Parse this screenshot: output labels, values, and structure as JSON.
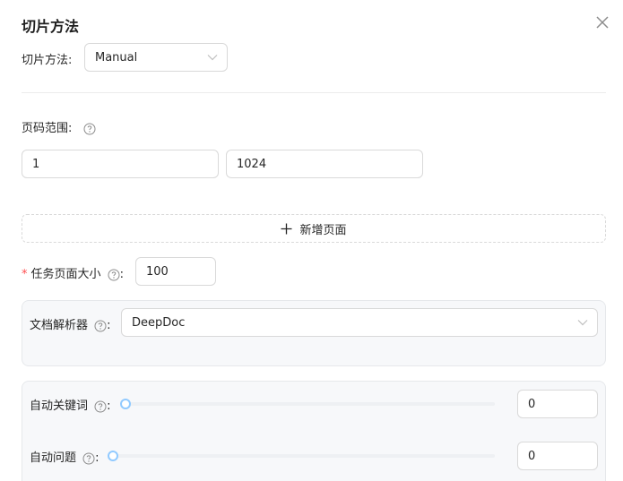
{
  "dialog": {
    "title": "切片方法",
    "method": {
      "label": "切片方法:",
      "value": "Manual"
    },
    "page_range": {
      "label": "页码范围:",
      "start": "1",
      "end": "1024"
    },
    "add_page_label": "新增页面",
    "task_page_size": {
      "label": "任务页面大小",
      "colon": ":",
      "value": "100"
    },
    "parser": {
      "label": "文档解析器",
      "colon": ":",
      "value": "DeepDoc"
    },
    "auto_keywords": {
      "label": "自动关键词",
      "colon": ":",
      "value": "0",
      "fraction": 0
    },
    "auto_questions": {
      "label": "自动问题",
      "colon": ":",
      "value": "0",
      "fraction": 0
    }
  },
  "icons": {
    "close": "close-icon",
    "help": "question-circle-icon",
    "chevron": "chevron-down-icon",
    "plus": "plus-icon"
  },
  "colors": {
    "required": "#ff4d4f",
    "slider": "#91caff",
    "border": "#d9d9d9",
    "panel_bg": "#f7f8fa"
  }
}
